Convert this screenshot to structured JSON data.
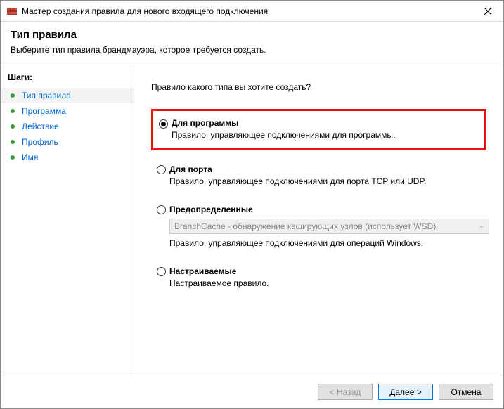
{
  "window": {
    "title": "Мастер создания правила для нового входящего подключения"
  },
  "header": {
    "title": "Тип правила",
    "description": "Выберите тип правила брандмауэра, которое требуется создать."
  },
  "sidebar": {
    "heading": "Шаги:",
    "steps": [
      {
        "label": "Тип правила",
        "current": true
      },
      {
        "label": "Программа",
        "current": false
      },
      {
        "label": "Действие",
        "current": false
      },
      {
        "label": "Профиль",
        "current": false
      },
      {
        "label": "Имя",
        "current": false
      }
    ]
  },
  "content": {
    "question": "Правило какого типа вы хотите создать?",
    "options": [
      {
        "id": "program",
        "label": "Для программы",
        "description": "Правило, управляющее подключениями для программы.",
        "checked": true,
        "highlighted": true
      },
      {
        "id": "port",
        "label": "Для порта",
        "description": "Правило, управляющее подключениями для порта TCP или UDP.",
        "checked": false
      },
      {
        "id": "predefined",
        "label": "Предопределенные",
        "description": "Правило, управляющее подключениями для операций Windows.",
        "checked": false,
        "dropdown": "BranchCache - обнаружение кэширующих узлов (использует WSD)"
      },
      {
        "id": "custom",
        "label": "Настраиваемые",
        "description": "Настраиваемое правило.",
        "checked": false
      }
    ]
  },
  "footer": {
    "back": "< Назад",
    "next": "Далее >",
    "cancel": "Отмена"
  }
}
